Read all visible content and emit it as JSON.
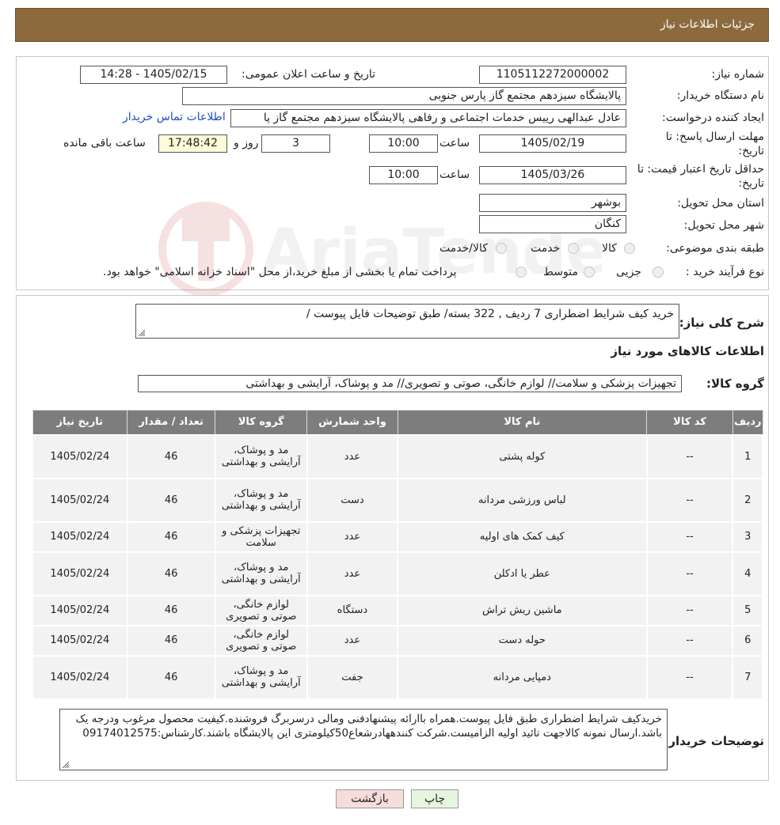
{
  "header": {
    "title": "جزئیات اطلاعات نیاز"
  },
  "form": {
    "need_number_label": "شماره نیاز:",
    "need_number": "1105112272000002",
    "announce_label": "تاریخ و ساعت اعلان عمومی:",
    "announce_value": "1405/02/15 - 14:28",
    "buyer_label": "نام دستگاه خریدار:",
    "buyer_value": "پالایشگاه سیزدهم مجتمع گاز پارس جنوبی",
    "creator_label": "ایجاد کننده درخواست:",
    "creator_value": "عادل عبدالهی رییس خدمات اجتماعی و رفاهی پالایشگاه سیزدهم مجتمع گاز پا",
    "contact_link": "اطلاعات تماس خریدار",
    "deadline_label_1": "مهلت ارسال پاسخ: تا",
    "deadline_label_2": "تاریخ:",
    "deadline_date": "1405/02/19",
    "time_label": "ساعت",
    "deadline_time": "10:00",
    "days_count": "3",
    "days_label": "روز و",
    "remaining_time": "17:48:42",
    "remaining_label": "ساعت باقی مانده",
    "validity_label_1": "حداقل تاریخ اعتبار قیمت: تا",
    "validity_label_2": "تاریخ:",
    "validity_date": "1405/03/26",
    "validity_time": "10:00",
    "province_label": "استان محل تحویل:",
    "province_value": "بوشهر",
    "city_label": "شهر محل تحویل:",
    "city_value": "کنگان",
    "category_label": "طبقه بندی موضوعی:",
    "category_options": [
      "کالا",
      "خدمت",
      "کالا/خدمت"
    ],
    "process_label": "نوع فرآیند خرید :",
    "process_options": [
      "جزیی",
      "متوسط"
    ],
    "process_note": "پرداخت تمام یا بخشی از مبلغ خرید،از محل \"اسناد خزانه اسلامی\" خواهد بود."
  },
  "watermark": {
    "text": "AriaTender.neT"
  },
  "summary": {
    "label": "شرح کلی نیاز:",
    "value": "خرید کیف شرایط اضطراری 7 ردیف , 322 بسته/ طبق توضیحات فایل پیوست /"
  },
  "goods": {
    "section_title": "اطلاعات کالاهای مورد نیاز",
    "group_label": "گروه کالا:",
    "group_value": "تجهیزات پزشکی و سلامت// لوازم خانگی، صوتی و تصویری// مد و پوشاک، آرایشی و بهداشتی"
  },
  "table": {
    "headers": [
      "ردیف",
      "کد کالا",
      "نام کالا",
      "واحد شمارش",
      "گروه کالا",
      "تعداد / مقدار",
      "تاریخ نیاز"
    ],
    "rows": [
      {
        "row": "1",
        "code": "--",
        "name": "کوله پشتی",
        "unit": "عدد",
        "group": "مد و پوشاک، آرایشی و بهداشتی",
        "qty": "46",
        "date": "1405/02/24"
      },
      {
        "row": "2",
        "code": "--",
        "name": "لباس ورزشی مردانه",
        "unit": "دست",
        "group": "مد و پوشاک، آرایشی و بهداشتی",
        "qty": "46",
        "date": "1405/02/24"
      },
      {
        "row": "3",
        "code": "--",
        "name": "کیف کمک های اولیه",
        "unit": "عدد",
        "group": "تجهیزات پزشکی و سلامت",
        "qty": "46",
        "date": "1405/02/24"
      },
      {
        "row": "4",
        "code": "--",
        "name": "عطر یا ادکلن",
        "unit": "عدد",
        "group": "مد و پوشاک، آرایشی و بهداشتی",
        "qty": "46",
        "date": "1405/02/24"
      },
      {
        "row": "5",
        "code": "--",
        "name": "ماشین ریش تراش",
        "unit": "دستگاه",
        "group": "لوازم خانگی، صوتی و تصویری",
        "qty": "46",
        "date": "1405/02/24"
      },
      {
        "row": "6",
        "code": "--",
        "name": "حوله دست",
        "unit": "عدد",
        "group": "لوازم خانگی، صوتی و تصویری",
        "qty": "46",
        "date": "1405/02/24"
      },
      {
        "row": "7",
        "code": "--",
        "name": "دمپایی مردانه",
        "unit": "جفت",
        "group": "مد و پوشاک، آرایشی و بهداشتی",
        "qty": "46",
        "date": "1405/02/24"
      }
    ]
  },
  "buyer_notes": {
    "label": "توضیحات خریدار:",
    "value": "خریدکیف شرایط اضطراری طبق فایل پیوست.همراه باارائه پیشنهادفنی ومالی درسربرگ فروشنده.کیفیت محصول مرغوب ودرجه یک باشد.ارسال نمونه کالاجهت تائید اولیه الزامیست.شرکت کنندههادرشعاع50کیلومتری این پالایشگاه باشند.کارشناس:09174012575"
  },
  "buttons": {
    "print": "چاپ",
    "back": "بازگشت"
  },
  "colors": {
    "header": "#8c6a3c",
    "table_header": "#7d7d7d",
    "link": "#1a4fc4",
    "back_button": "#f7dcdc",
    "print_button": "#e6f5e0"
  }
}
